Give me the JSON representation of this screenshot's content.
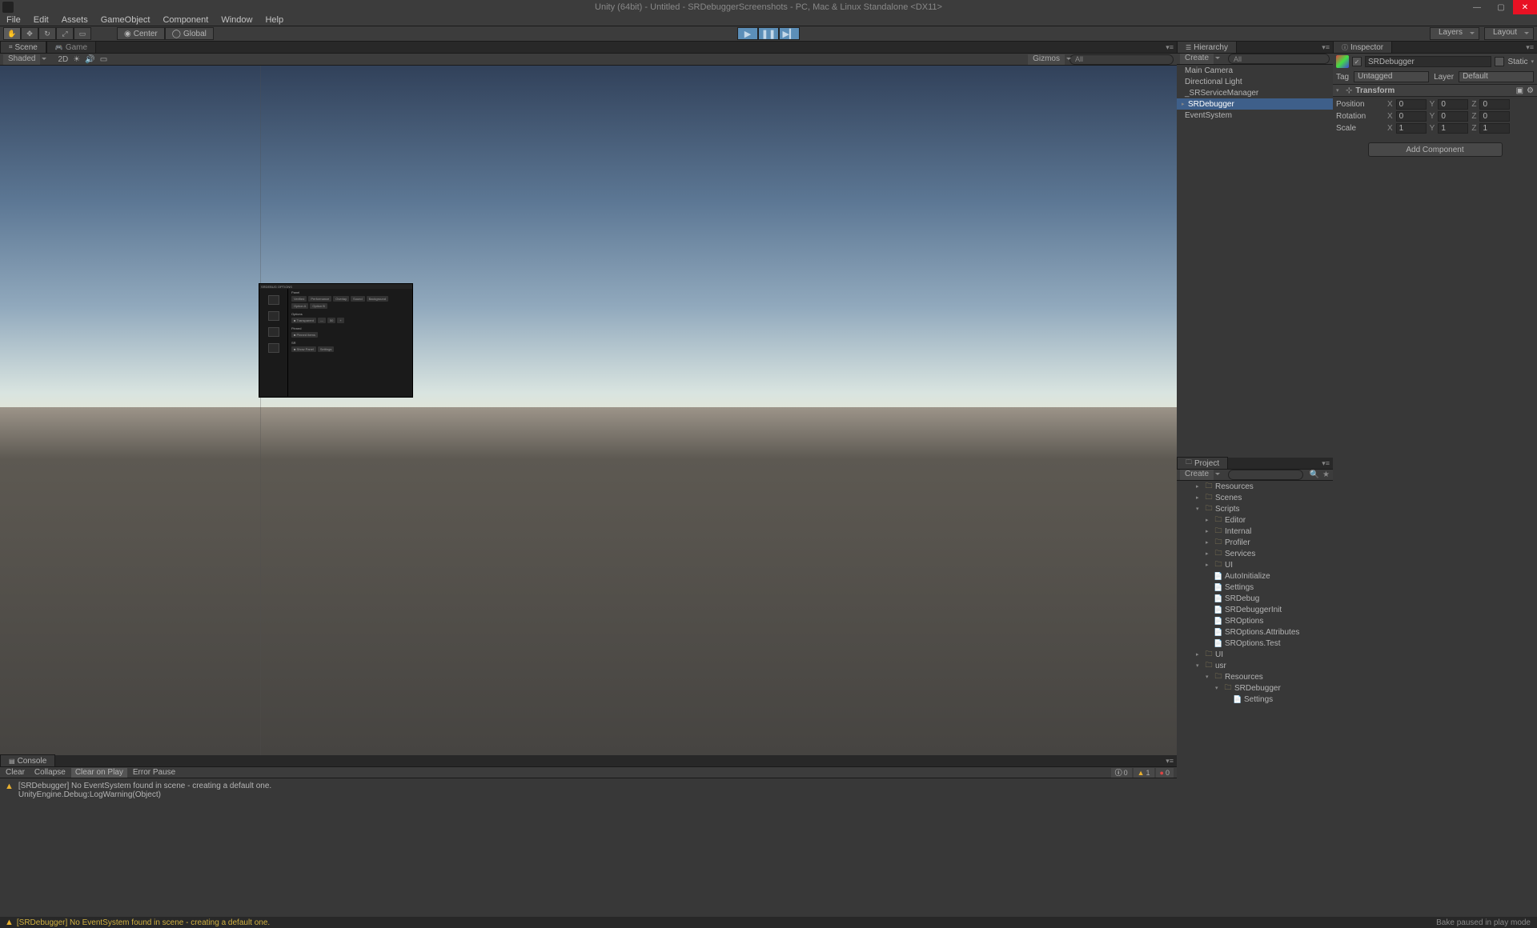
{
  "window": {
    "title": "Unity (64bit) - Untitled - SRDebuggerScreenshots - PC, Mac & Linux Standalone <DX11>"
  },
  "menu": {
    "items": [
      "File",
      "Edit",
      "Assets",
      "GameObject",
      "Component",
      "Window",
      "Help"
    ]
  },
  "toolbar": {
    "pivot_center": "Center",
    "pivot_global": "Global",
    "layers": "Layers",
    "layout": "Layout"
  },
  "scene": {
    "tab_scene": "Scene",
    "tab_game": "Game",
    "shading": "Shaded",
    "mode_2d": "2D",
    "gizmos": "Gizmos",
    "search": "All"
  },
  "hierarchy": {
    "title": "Hierarchy",
    "create": "Create",
    "search": "All",
    "items": [
      {
        "label": "Main Camera",
        "selected": false,
        "foldout": ""
      },
      {
        "label": "Directional Light",
        "selected": false,
        "foldout": ""
      },
      {
        "label": "_SRServiceManager",
        "selected": false,
        "foldout": ""
      },
      {
        "label": "SRDebugger",
        "selected": true,
        "foldout": "▸"
      },
      {
        "label": "EventSystem",
        "selected": false,
        "foldout": ""
      }
    ]
  },
  "inspector": {
    "title": "Inspector",
    "object_name": "SRDebugger",
    "static": "Static",
    "tag_label": "Tag",
    "tag_value": "Untagged",
    "layer_label": "Layer",
    "layer_value": "Default",
    "transform": {
      "title": "Transform",
      "position": {
        "label": "Position",
        "x": "0",
        "y": "0",
        "z": "0"
      },
      "rotation": {
        "label": "Rotation",
        "x": "0",
        "y": "0",
        "z": "0"
      },
      "scale": {
        "label": "Scale",
        "x": "1",
        "y": "1",
        "z": "1"
      }
    },
    "add_component": "Add Component"
  },
  "project": {
    "title": "Project",
    "create": "Create",
    "items": [
      {
        "indent": 2,
        "type": "folder",
        "label": "Resources",
        "foldout": "▸"
      },
      {
        "indent": 2,
        "type": "folder",
        "label": "Scenes",
        "foldout": "▸"
      },
      {
        "indent": 2,
        "type": "folder",
        "label": "Scripts",
        "foldout": "▾"
      },
      {
        "indent": 3,
        "type": "folder",
        "label": "Editor",
        "foldout": "▸"
      },
      {
        "indent": 3,
        "type": "folder",
        "label": "Internal",
        "foldout": "▸"
      },
      {
        "indent": 3,
        "type": "folder",
        "label": "Profiler",
        "foldout": "▸"
      },
      {
        "indent": 3,
        "type": "folder",
        "label": "Services",
        "foldout": "▸"
      },
      {
        "indent": 3,
        "type": "folder",
        "label": "UI",
        "foldout": "▸"
      },
      {
        "indent": 3,
        "type": "file",
        "label": "AutoInitialize",
        "foldout": ""
      },
      {
        "indent": 3,
        "type": "file",
        "label": "Settings",
        "foldout": ""
      },
      {
        "indent": 3,
        "type": "file",
        "label": "SRDebug",
        "foldout": ""
      },
      {
        "indent": 3,
        "type": "file",
        "label": "SRDebuggerInit",
        "foldout": ""
      },
      {
        "indent": 3,
        "type": "file",
        "label": "SROptions",
        "foldout": ""
      },
      {
        "indent": 3,
        "type": "file",
        "label": "SROptions.Attributes",
        "foldout": ""
      },
      {
        "indent": 3,
        "type": "file",
        "label": "SROptions.Test",
        "foldout": ""
      },
      {
        "indent": 2,
        "type": "folder",
        "label": "UI",
        "foldout": "▸"
      },
      {
        "indent": 2,
        "type": "folder",
        "label": "usr",
        "foldout": "▾"
      },
      {
        "indent": 3,
        "type": "folder",
        "label": "Resources",
        "foldout": "▾"
      },
      {
        "indent": 4,
        "type": "folder",
        "label": "SRDebugger",
        "foldout": "▾"
      },
      {
        "indent": 5,
        "type": "file",
        "label": "Settings",
        "foldout": ""
      }
    ]
  },
  "console": {
    "title": "Console",
    "clear": "Clear",
    "collapse": "Collapse",
    "clear_on_play": "Clear on Play",
    "error_pause": "Error Pause",
    "counts": {
      "info": "0",
      "warn": "1",
      "error": "0"
    },
    "message": {
      "line1": "[SRDebugger] No EventSystem found in scene - creating a default one.",
      "line2": "UnityEngine.Debug:LogWarning(Object)"
    }
  },
  "statusbar": {
    "message": "[SRDebugger] No EventSystem found in scene - creating a default one.",
    "right": "Bake paused in play mode"
  },
  "debugger": {
    "title": "SRDEBUG OPTIONS"
  }
}
